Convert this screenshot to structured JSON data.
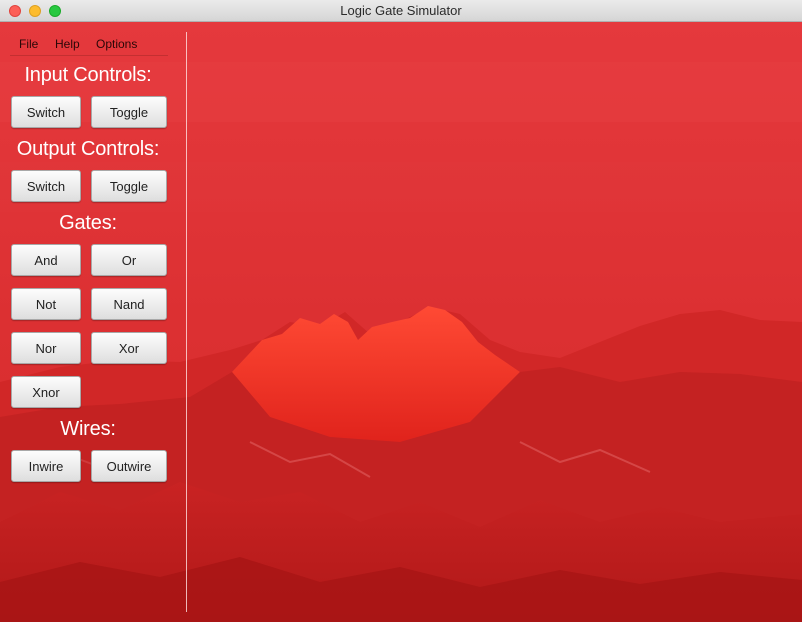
{
  "window": {
    "title": "Logic Gate Simulator"
  },
  "menu": {
    "file": "File",
    "help": "Help",
    "options": "Options"
  },
  "input_controls": {
    "heading": "Input Controls:",
    "switch_label": "Switch",
    "toggle_label": "Toggle"
  },
  "output_controls": {
    "heading": "Output Controls:",
    "switch_label": "Switch",
    "toggle_label": "Toggle"
  },
  "gates": {
    "heading": "Gates:",
    "and": "And",
    "or": "Or",
    "not": "Not",
    "nand": "Nand",
    "nor": "Nor",
    "xor": "Xor",
    "xnor": "Xnor"
  },
  "wires": {
    "heading": "Wires:",
    "inwire": "Inwire",
    "outwire": "Outwire"
  },
  "colors": {
    "background_tint": "#d42a2a",
    "sky_top": "#e23a3e",
    "mountain_peak": "#ff3a2a",
    "mountain_base": "#b81a1a",
    "heading_text": "#ffffff"
  }
}
